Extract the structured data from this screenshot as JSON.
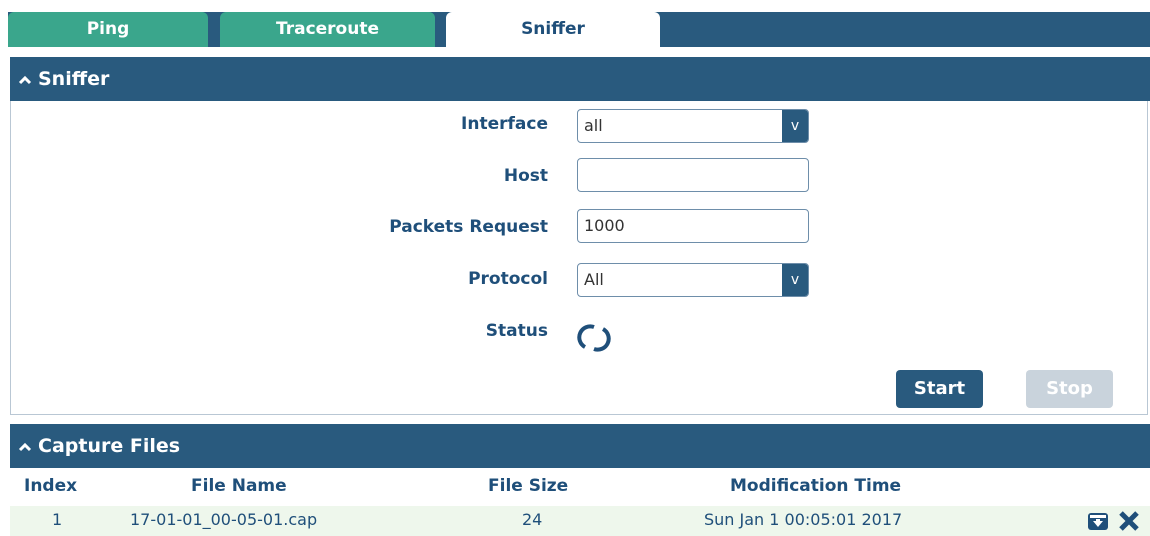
{
  "tabs": [
    {
      "label": "Ping"
    },
    {
      "label": "Traceroute"
    },
    {
      "label": "Sniffer"
    }
  ],
  "sniffer": {
    "section_title": "Sniffer",
    "interface": {
      "label": "Interface",
      "value": "all"
    },
    "host": {
      "label": "Host",
      "value": ""
    },
    "packets_request": {
      "label": "Packets Request",
      "value": "1000"
    },
    "protocol": {
      "label": "Protocol",
      "value": "All"
    },
    "status": {
      "label": "Status"
    },
    "start_label": "Start",
    "stop_label": "Stop",
    "select_arrow": "v"
  },
  "capture_files": {
    "section_title": "Capture Files",
    "columns": [
      "Index",
      "File Name",
      "File Size",
      "Modification Time"
    ],
    "rows": [
      {
        "index": "1",
        "file_name": "17-01-01_00-05-01.cap",
        "file_size": "24",
        "modification_time": "Sun Jan 1 00:05:01 2017"
      }
    ]
  },
  "colors": {
    "header_blue": "#295a7e",
    "tab_green": "#3aa68c",
    "stop_disabled": "#c9d3dc",
    "row_bg": "#eef7ec"
  }
}
